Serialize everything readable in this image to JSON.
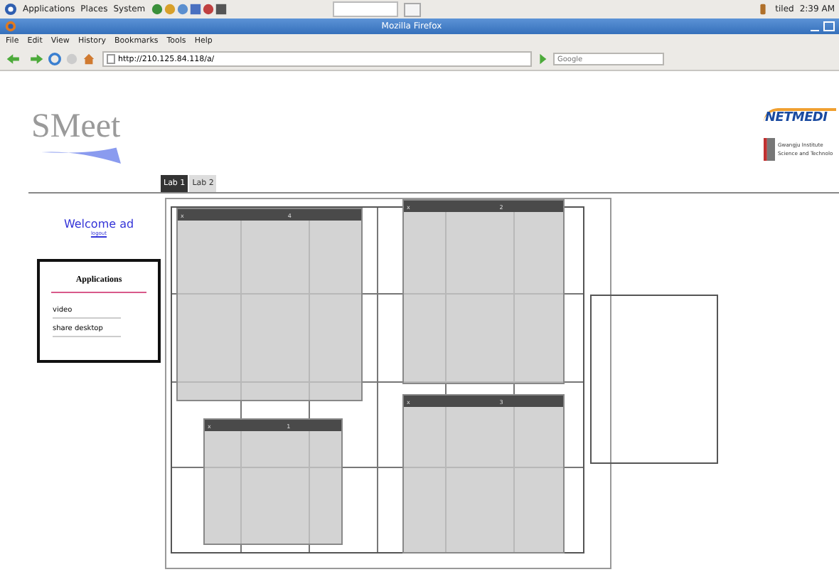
{
  "top_panel": {
    "menus": [
      "Applications",
      "Places",
      "System"
    ],
    "user": "tiled",
    "clock": "2:39 AM"
  },
  "window": {
    "title": "Mozilla Firefox"
  },
  "menu_bar": [
    "File",
    "Edit",
    "View",
    "History",
    "Bookmarks",
    "Tools",
    "Help"
  ],
  "toolbar": {
    "url": "http://210.125.84.118/a/",
    "search": {
      "placeholder": "Google"
    }
  },
  "page": {
    "logo": "SMeet",
    "partner_logo": "NETMEDI",
    "institute": [
      "Gwangju Institute",
      "Science and Technolo"
    ],
    "tabs": [
      {
        "label": "Lab 1",
        "selected": true
      },
      {
        "label": "Lab 2",
        "selected": false
      }
    ],
    "welcome": "Welcome ad",
    "logout": "logout",
    "applications": {
      "title": "Applications",
      "items": [
        "video",
        "share desktop"
      ]
    },
    "video_windows": [
      {
        "close": "x",
        "title": "4"
      },
      {
        "close": "x",
        "title": "2"
      },
      {
        "close": "x",
        "title": "1"
      },
      {
        "close": "x",
        "title": "3"
      }
    ]
  }
}
